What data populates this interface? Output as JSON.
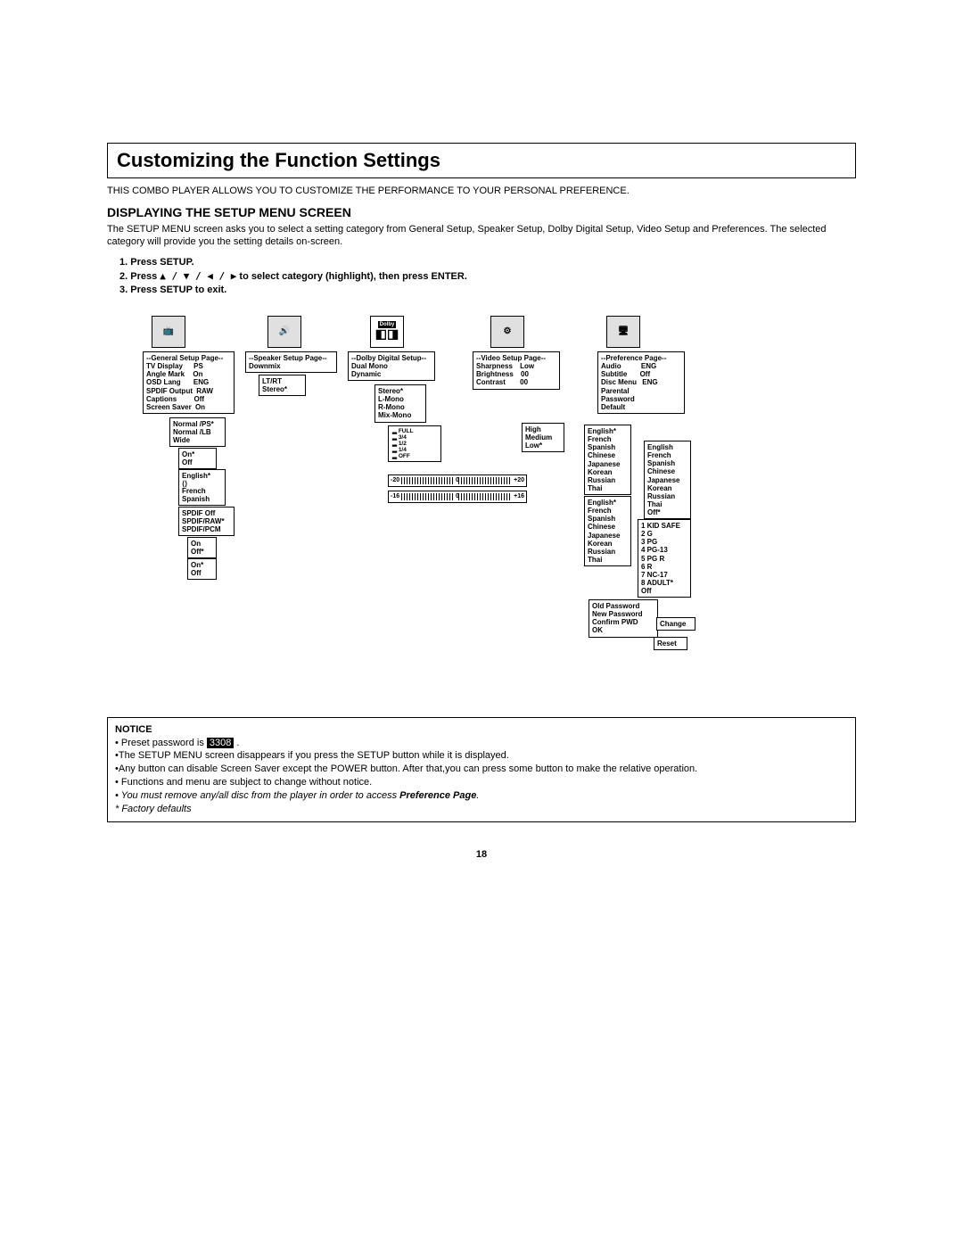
{
  "title": "Customizing the Function Settings",
  "intro": "THIS COMBO PLAYER ALLOWS YOU TO CUSTOMIZE THE PERFORMANCE TO YOUR PERSONAL PREFERENCE.",
  "subhead": "DISPLAYING THE SETUP MENU SCREEN",
  "subdesc": "The SETUP MENU screen asks you to select a setting category from General Setup, Speaker Setup, Dolby Digital Setup, Video Setup and Preferences.  The selected category will provide you the setting details on-screen.",
  "steps": {
    "s1": "1. Press SETUP.",
    "s2a": "2. Press ",
    "s2b": "▲ / ▼ / ◀ / ▶",
    "s2c": " to select category (highlight), then press ENTER.",
    "s3": "3. Press SETUP to exit."
  },
  "general": {
    "header": "--General Setup Page--",
    "items": [
      {
        "k": "TV Display",
        "v": "PS"
      },
      {
        "k": "Angle Mark",
        "v": "On"
      },
      {
        "k": "OSD Lang",
        "v": "ENG"
      },
      {
        "k": "SPDIF Output",
        "v": "RAW"
      },
      {
        "k": "Captions",
        "v": "Off"
      },
      {
        "k": "Screen Saver",
        "v": "On"
      }
    ],
    "tv": [
      "Normal /PS*",
      "Normal /LB",
      "Wide"
    ],
    "angle": [
      "On*",
      "Off"
    ],
    "osd": [
      "English*",
      "",
      "French",
      "Spanish"
    ],
    "spdif": [
      "SPDIF Off",
      "SPDIF/RAW*",
      "SPDIF/PCM"
    ],
    "captions": [
      "On",
      "Off*"
    ],
    "screen": [
      "On*",
      "Off"
    ]
  },
  "speaker": {
    "header": "--Speaker Setup Page--",
    "items": [
      {
        "k": "Downmix",
        "v": ""
      }
    ],
    "downmix": [
      "LT/RT",
      "Stereo*"
    ]
  },
  "dolby": {
    "header": "--Dolby Digital Setup--",
    "label": "Dolby",
    "items": [
      {
        "k": "Dual Mono",
        "v": ""
      },
      {
        "k": "Dynamic",
        "v": ""
      }
    ],
    "dual": [
      "Stereo*",
      "L-Mono",
      "R-Mono",
      "Mix-Mono"
    ],
    "dynamic": [
      "FULL",
      "3/4",
      "1/2",
      "1/4",
      "OFF"
    ]
  },
  "video": {
    "header": "--Video Setup Page--",
    "items": [
      {
        "k": "Sharpness",
        "v": "Low"
      },
      {
        "k": "Brightness",
        "v": "00"
      },
      {
        "k": "Contrast",
        "v": "00"
      }
    ],
    "sharp": [
      "High",
      "Medium",
      "Low*"
    ],
    "bright": {
      "lo": "-20",
      "mid": "0",
      "hi": "+20"
    },
    "contrast": {
      "lo": "-16",
      "mid": "0",
      "hi": "+16"
    }
  },
  "pref": {
    "header": "--Preference Page--",
    "items": [
      {
        "k": "Audio",
        "v": "ENG"
      },
      {
        "k": "Subtitle",
        "v": "Off"
      },
      {
        "k": "Disc Menu",
        "v": "ENG"
      },
      {
        "k": "Parental",
        "v": ""
      },
      {
        "k": "Password",
        "v": ""
      },
      {
        "k": "Default",
        "v": ""
      }
    ],
    "audio": [
      "English*",
      "French",
      "Spanish",
      "Chinese",
      "Japanese",
      "Korean",
      "Russian",
      "Thai"
    ],
    "sub": [
      "English",
      "French",
      "Spanish",
      "Chinese",
      "Japanese",
      "Korean",
      "Russian",
      "Thai",
      "Off*"
    ],
    "disc": [
      "English*",
      "French",
      "Spanish",
      "Chinese",
      "Japanese",
      "Korean",
      "Russian",
      "Thai"
    ],
    "parental": [
      "1 KID SAFE",
      "2 G",
      "3 PG",
      "4 PG-13",
      "5 PG R",
      "6 R",
      "7 NC-17",
      "8 ADULT*",
      "   Off"
    ],
    "password": [
      {
        "k": "Old  Password",
        "v": ""
      },
      {
        "k": "New Password",
        "v": ""
      },
      {
        "k": "Confirm  PWD",
        "v": ""
      },
      {
        "k": "        OK",
        "v": ""
      }
    ],
    "change": "Change",
    "default": "Reset"
  },
  "notice": {
    "title": "NOTICE",
    "l1a": "• Preset password is ",
    "l1b": "3308",
    "l1c": " .",
    "l2": "•The SETUP MENU screen disappears if you press the SETUP button while it is displayed.",
    "l3": "•Any button can disable Screen Saver except the POWER button. After that,you can press some button to make the relative operation.",
    "l4": "• Functions and menu are subject to change without notice.",
    "l5a": "• You must remove any/all disc from the player in order to access  ",
    "l5b": "Preference Page",
    "l5c": ".",
    "l6": "* Factory defaults"
  },
  "page_num": "18"
}
